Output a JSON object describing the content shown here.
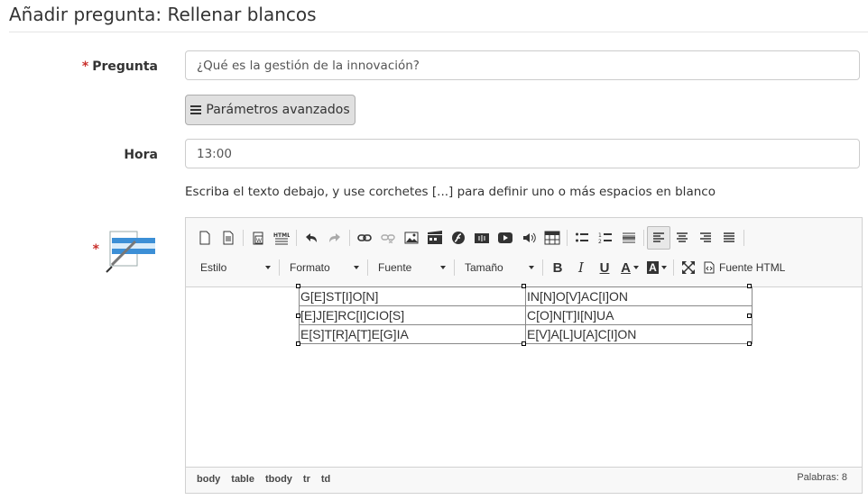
{
  "page": {
    "title": "Añadir pregunta: Rellenar blancos"
  },
  "form": {
    "question": {
      "required_mark": "*",
      "label": "Pregunta",
      "value": "¿Qué es la gestión de la innovación?"
    },
    "advanced_button": {
      "label": "Parámetros avanzados",
      "icon": "bars-icon"
    },
    "time": {
      "label": "Hora",
      "value": "13:00"
    },
    "help_text": "Escriba el texto debajo, y use corchetes [...] para definir uno o más espacios en blanco",
    "editor_required_mark": "*"
  },
  "editor": {
    "toolbar_row1": [
      {
        "name": "new-page",
        "icon": "new-page-icon"
      },
      {
        "name": "preview",
        "icon": "preview-icon"
      },
      {
        "name": "paste-word",
        "icon": "paste-word-icon"
      },
      {
        "name": "html-template",
        "icon": "html-template-icon",
        "text": "HTML"
      },
      {
        "name": "undo",
        "icon": "undo-icon"
      },
      {
        "name": "redo",
        "icon": "redo-icon"
      },
      {
        "name": "link",
        "icon": "link-icon"
      },
      {
        "name": "unlink",
        "icon": "unlink-icon"
      },
      {
        "name": "image",
        "icon": "image-icon"
      },
      {
        "name": "video",
        "icon": "video-icon"
      },
      {
        "name": "flash",
        "icon": "flash-icon"
      },
      {
        "name": "audio",
        "icon": "audio-icon"
      },
      {
        "name": "youtube",
        "icon": "youtube-icon"
      },
      {
        "name": "sound",
        "icon": "sound-icon"
      },
      {
        "name": "table",
        "icon": "table-icon"
      },
      {
        "name": "bulleted-list",
        "icon": "bulleted-list-icon"
      },
      {
        "name": "numbered-list",
        "icon": "numbered-list-icon"
      },
      {
        "name": "horizontal-line",
        "icon": "horizontal-line-icon"
      },
      {
        "name": "align-left",
        "icon": "align-left-icon",
        "active": true
      },
      {
        "name": "align-center",
        "icon": "align-center-icon"
      },
      {
        "name": "align-right",
        "icon": "align-right-icon"
      },
      {
        "name": "justify",
        "icon": "justify-icon"
      }
    ],
    "combos": {
      "style": "Estilo",
      "format": "Formato",
      "font": "Fuente",
      "size": "Tamaño"
    },
    "format_buttons": {
      "bold": "B",
      "italic": "I",
      "underline": "U",
      "text_color": "A",
      "bg_color": "A"
    },
    "source_label": "Fuente HTML",
    "table": [
      [
        "G[E]ST[I]O[N]",
        "IN[N]O[V]AC[I]ON"
      ],
      [
        "[E]J[E]RC[I]CIO[S]",
        "C[O]N[T]I[N]UA"
      ],
      [
        "E[S]T[R]A[T]E[G]IA",
        "E[V]A[L]U[A]C[I]ON"
      ]
    ],
    "path": [
      "body",
      "table",
      "tbody",
      "tr",
      "td"
    ],
    "word_count": "Palabras: 8"
  },
  "colors": {
    "required": "#c9302c",
    "button_bg": "#e0e0e0",
    "toolbar_bg": "#f8f8f8"
  }
}
